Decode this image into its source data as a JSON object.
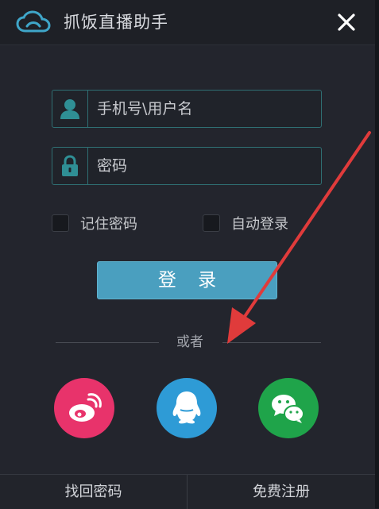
{
  "app": {
    "title": "抓饭直播助手",
    "accent_color": "#4a9fbf",
    "field_border_color": "#2f6f73"
  },
  "titlebar": {
    "logo_icon": "cloud-logo-icon",
    "close_icon": "close-icon"
  },
  "form": {
    "username": {
      "placeholder": "手机号\\用户名",
      "value": "",
      "icon": "user-icon"
    },
    "password": {
      "placeholder": "密码",
      "value": "",
      "icon": "lock-icon"
    },
    "remember_password": {
      "label": "记住密码",
      "checked": false
    },
    "auto_login": {
      "label": "自动登录",
      "checked": false
    },
    "login_label": "登 录"
  },
  "alt_login": {
    "divider_text": "或者",
    "providers": [
      {
        "name": "weibo",
        "icon": "weibo-icon",
        "color": "#e8336b"
      },
      {
        "name": "qq",
        "icon": "qq-icon",
        "color": "#2e9bd6"
      },
      {
        "name": "wechat",
        "icon": "wechat-icon",
        "color": "#1fa44a"
      }
    ]
  },
  "annotation": {
    "arrow_color": "#e03b3b"
  },
  "footer": {
    "forgot_password": "找回密码",
    "register": "免费注册"
  }
}
